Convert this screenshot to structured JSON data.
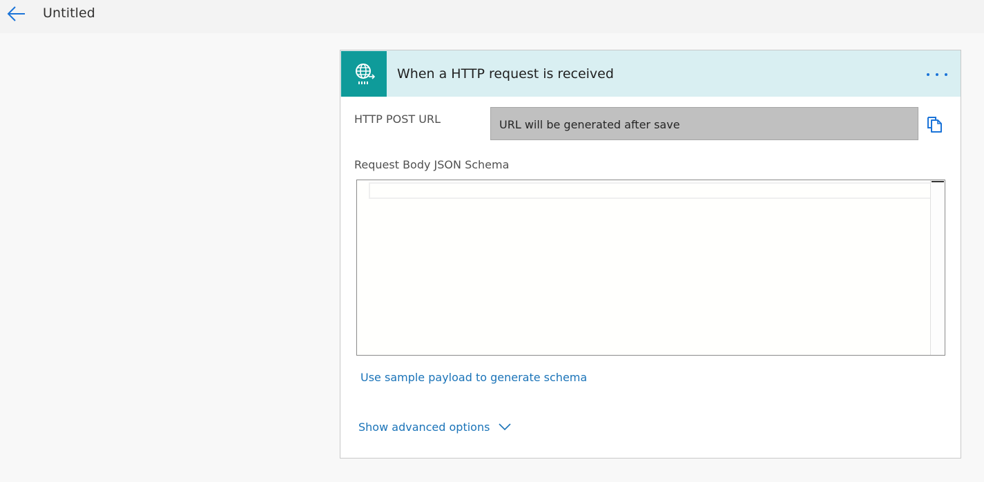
{
  "header": {
    "title": "Untitled",
    "back_icon": "arrow-left-icon"
  },
  "trigger": {
    "title": "When a HTTP request is received",
    "icon": "http-globe-icon",
    "accent_color": "#0f9b9a",
    "header_color": "#d9eff2",
    "menu_icon": "more-horizontal-icon"
  },
  "fields": {
    "url_label": "HTTP POST URL",
    "url_value": "URL will be generated after save",
    "copy_icon": "copy-icon",
    "schema_label": "Request Body JSON Schema",
    "schema_value": ""
  },
  "links": {
    "sample_payload": "Use sample payload to generate schema",
    "advanced_options": "Show advanced options",
    "link_color": "#1a73b8"
  }
}
